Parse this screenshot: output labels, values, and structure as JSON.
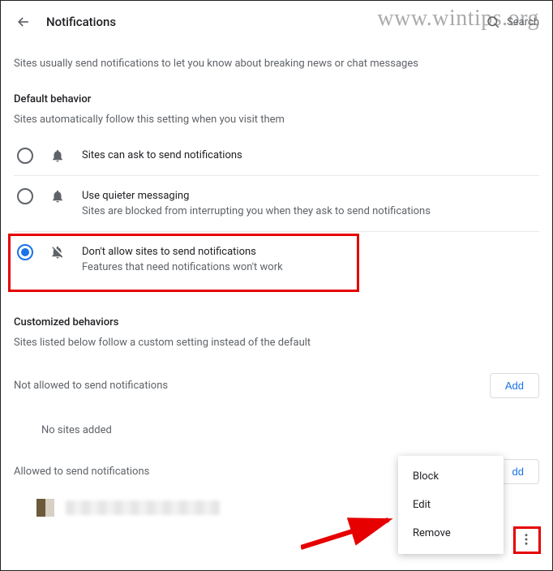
{
  "header": {
    "title": "Notifications",
    "search_label": "Search"
  },
  "intro": "Sites usually send notifications to let you know about breaking news or chat messages",
  "default_behavior": {
    "heading": "Default behavior",
    "subheading": "Sites automatically follow this setting when you visit them",
    "options": [
      {
        "id": "ask",
        "primary": "Sites can ask to send notifications",
        "secondary": "",
        "selected": false,
        "icon": "bell-icon"
      },
      {
        "id": "quieter",
        "primary": "Use quieter messaging",
        "secondary": "Sites are blocked from interrupting you when they ask to send notifications",
        "selected": false,
        "icon": "bell-icon"
      },
      {
        "id": "dont-allow",
        "primary": "Don't allow sites to send notifications",
        "secondary": "Features that need notifications won't work",
        "selected": true,
        "icon": "bell-off-icon"
      }
    ]
  },
  "customized": {
    "heading": "Customized behaviors",
    "subheading": "Sites listed below follow a custom setting instead of the default"
  },
  "not_allowed": {
    "label": "Not allowed to send notifications",
    "add_label": "Add",
    "empty_text": "No sites added"
  },
  "allowed": {
    "label": "Allowed to send notifications",
    "add_label": "dd"
  },
  "context_menu": {
    "items": [
      "Block",
      "Edit",
      "Remove"
    ]
  },
  "watermark": "www.wintips.org",
  "colors": {
    "accent_blue": "#1a73e8",
    "highlight_red": "#e60000",
    "text_secondary": "#5f6368"
  }
}
